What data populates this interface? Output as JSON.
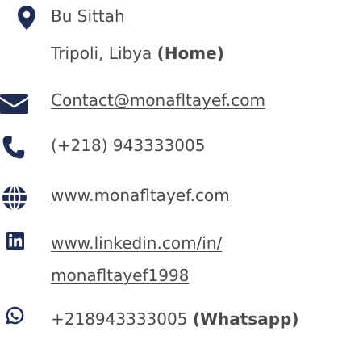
{
  "colors": {
    "icon": "#1f2d55",
    "text": "#4a4a4a"
  },
  "contact": {
    "address": {
      "icon": "map-pin-icon",
      "line1": "Bu Sittah",
      "line2": "Tripoli, Libya",
      "tag": "(Home)"
    },
    "email": {
      "icon": "envelope-icon",
      "label": "Contact@monafltayef.com"
    },
    "phone": {
      "icon": "phone-icon",
      "label": "(+218) 943333005"
    },
    "website": {
      "icon": "globe-icon",
      "label": "www.monafltayef.com"
    },
    "linkedin": {
      "icon": "linkedin-icon",
      "line1": "www.linkedin.com/in/",
      "line2": "monafltayef1998"
    },
    "whatsapp": {
      "icon": "whatsapp-icon",
      "number": "+218943333005",
      "tag": "(Whatsapp)"
    }
  }
}
